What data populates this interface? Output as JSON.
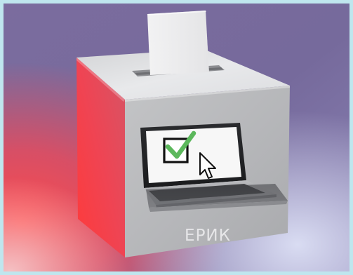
{
  "box_label": "ЕРИК",
  "icons": {
    "checkbox": "checkmark-icon",
    "cursor": "mouse-cursor-icon"
  },
  "colors": {
    "frame": "#bfe6ee",
    "box_front": "#b7b8ba",
    "box_top": "#e1e2e4",
    "box_side_red": "#f0434e",
    "checkmark": "#5cb85c",
    "label_text": "#e6e6e8"
  }
}
